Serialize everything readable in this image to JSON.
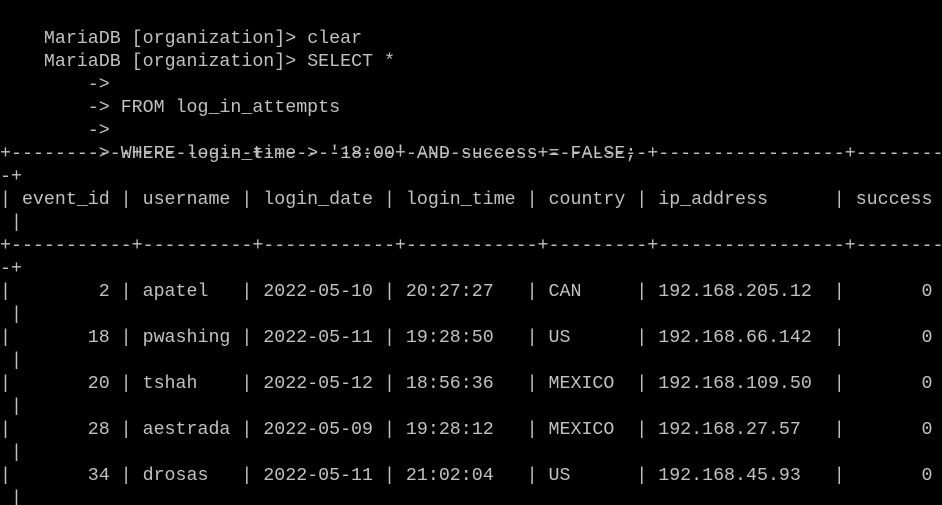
{
  "terminal": {
    "lines": [
      {
        "prompt": "MariaDB [organization]> ",
        "text": "clear"
      },
      {
        "prompt": "MariaDB [organization]> ",
        "text": "SELECT *"
      },
      {
        "prompt": "    -> ",
        "text": ""
      },
      {
        "prompt": "    -> ",
        "text": "FROM log_in_attempts"
      },
      {
        "prompt": "    -> ",
        "text": ""
      },
      {
        "prompt": "    -> ",
        "text": "WHERE login_time > '18:00' AND success = FALSE;"
      },
      {
        "prompt": "",
        "text": "+-----------+----------+------------+------------+---------+-----------------+---------"
      },
      {
        "prompt": "",
        "text": "-+"
      },
      {
        "prompt": "",
        "text": "| event_id | username | login_date | login_time | country | ip_address      | success"
      },
      {
        "prompt": "",
        "text": " |"
      },
      {
        "prompt": "",
        "text": "+-----------+----------+------------+------------+---------+-----------------+---------"
      },
      {
        "prompt": "",
        "text": "-+"
      },
      {
        "prompt": "",
        "text": "|        2 | apatel   | 2022-05-10 | 20:27:27   | CAN     | 192.168.205.12  |       0"
      },
      {
        "prompt": "",
        "text": " |"
      },
      {
        "prompt": "",
        "text": "|       18 | pwashing | 2022-05-11 | 19:28:50   | US      | 192.168.66.142  |       0"
      },
      {
        "prompt": "",
        "text": " |"
      },
      {
        "prompt": "",
        "text": "|       20 | tshah    | 2022-05-12 | 18:56:36   | MEXICO  | 192.168.109.50  |       0"
      },
      {
        "prompt": "",
        "text": " |"
      },
      {
        "prompt": "",
        "text": "|       28 | aestrada | 2022-05-09 | 19:28:12   | MEXICO  | 192.168.27.57   |       0"
      },
      {
        "prompt": "",
        "text": " |"
      },
      {
        "prompt": "",
        "text": "|       34 | drosas   | 2022-05-11 | 21:02:04   | US      | 192.168.45.93   |       0"
      },
      {
        "prompt": "",
        "text": " |"
      }
    ]
  },
  "colors": {
    "background": "#000000",
    "text": "#c0c0c0"
  }
}
